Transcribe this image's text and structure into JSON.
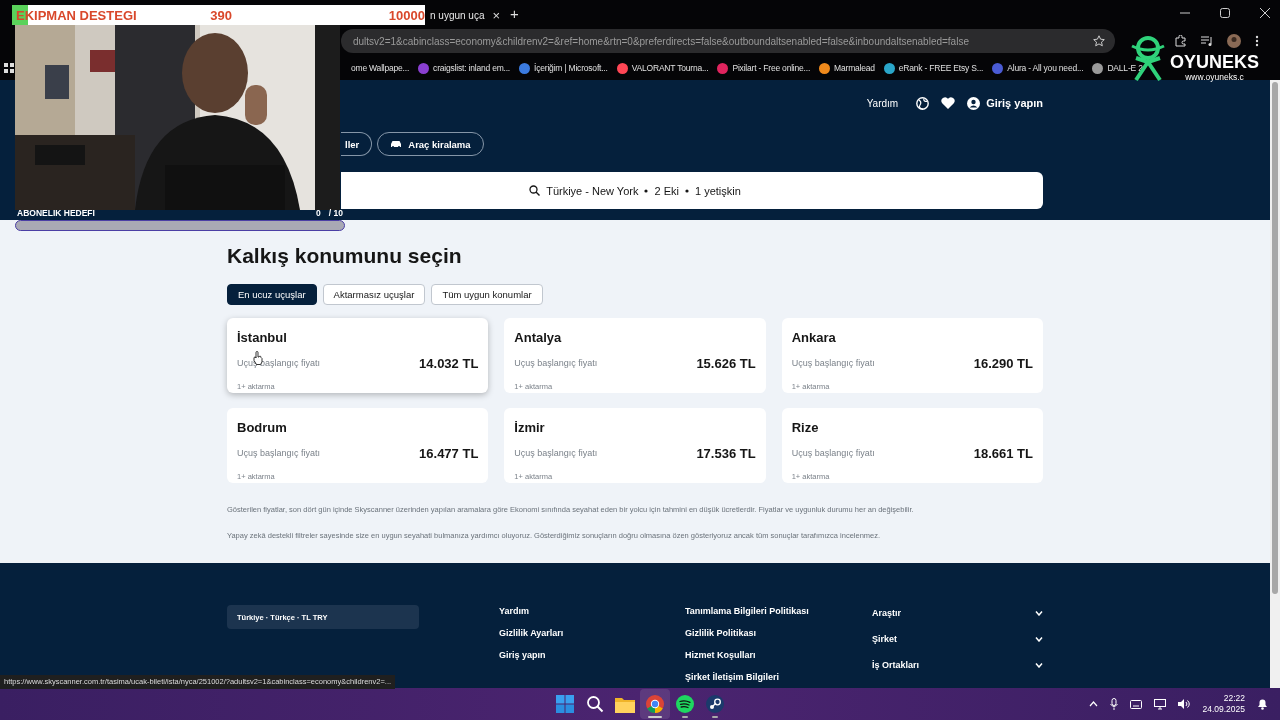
{
  "browser": {
    "tab": {
      "title": "n uygun uça",
      "close": "×"
    },
    "new_tab": "+",
    "url": "dultsv2=1&cabinclass=economy&childrenv2=&ref=home&rtn=0&preferdirects=false&outboundaltsenabled=false&inboundaltsenabled=false",
    "bookmarks": [
      {
        "label": "ome Wallpape..."
      },
      {
        "label": "craigslist: inland em...",
        "color": "#8a3fd1"
      },
      {
        "label": "İçeriğim | Microsoft...",
        "color": "#3b7be0"
      },
      {
        "label": "VALORANT Tourna...",
        "color": "#ff4655"
      },
      {
        "label": "Pixilart - Free online...",
        "color": "#e0245e"
      },
      {
        "label": "Marmalead",
        "color": "#f08a1c"
      },
      {
        "label": "eRank - FREE Etsy S...",
        "color": "#2aa6c9"
      },
      {
        "label": "Alura - All you need...",
        "color": "#4a5bd4"
      },
      {
        "label": "DALL-E 2",
        "color": "#9a9a9a"
      }
    ]
  },
  "stream_overlay": {
    "donation": {
      "label": "EKIPMAN DESTEGI",
      "current": "390",
      "goal": "10000",
      "level": 0.039
    },
    "subscription": {
      "label": "ABONELIK HEDEFI",
      "count": "0",
      "goal": "/ 10",
      "level": 0
    },
    "logo": {
      "name": "OYUNEKS",
      "url": "www.oyuneks.c"
    }
  },
  "header": {
    "help": "Yardım",
    "login": "Giriş yapın",
    "chips": [
      "ller",
      "Araç kiralama"
    ],
    "search_summary": [
      "Türkiye - New York",
      "2 Eki",
      "1 yetişkin"
    ]
  },
  "main": {
    "title": "Kalkış konumunu seçin",
    "filters": [
      {
        "label": "En ucuz uçuşlar",
        "selected": true
      },
      {
        "label": "Aktarmasız uçuşlar",
        "selected": false
      },
      {
        "label": "Tüm uygun konumlar",
        "selected": false
      }
    ],
    "cards": [
      {
        "city": "İstanbul",
        "label": "Uçuş başlangıç fiyatı",
        "price": "14.032 TL",
        "stops": "1+ aktarma",
        "hovered": true
      },
      {
        "city": "Antalya",
        "label": "Uçuş başlangıç fiyatı",
        "price": "15.626 TL",
        "stops": "1+ aktarma",
        "hovered": false
      },
      {
        "city": "Ankara",
        "label": "Uçuş başlangıç fiyatı",
        "price": "16.290 TL",
        "stops": "1+ aktarma",
        "hovered": false
      },
      {
        "city": "Bodrum",
        "label": "Uçuş başlangıç fiyatı",
        "price": "16.477 TL",
        "stops": "1+ aktarma",
        "hovered": false
      },
      {
        "city": "İzmir",
        "label": "Uçuş başlangıç fiyatı",
        "price": "17.536 TL",
        "stops": "1+ aktarma",
        "hovered": false
      },
      {
        "city": "Rize",
        "label": "Uçuş başlangıç fiyatı",
        "price": "18.661 TL",
        "stops": "1+ aktarma",
        "hovered": false
      }
    ],
    "disclaimers": [
      "Gösterilen fiyatlar, son dört gün içinde Skyscanner üzerinden yapılan aramalara göre Ekonomi sınıfında seyahat eden bir yolcu için tahmini en düşük ücretlerdir. Fiyatlar ve uygunluk durumu her an değişebilir.",
      "Yapay zekâ destekli filtreler sayesinde size en uygun seyahati bulmanıza yardımcı oluyoruz. Gösterdiğimiz sonuçların doğru olmasına özen gösteriyoruz ancak tüm sonuçlar tarafımızca incelenmez."
    ]
  },
  "footer": {
    "locale": "Türkiye · Türkçe · TL TRY",
    "links_1": [
      "Yardım",
      "Gizlilik Ayarları",
      "Giriş yapın"
    ],
    "links_2": [
      "Tanımlama Bilgileri Politikası",
      "Gizlilik Politikası",
      "Hizmet Koşulları",
      "Şirket İletişim Bilgileri"
    ],
    "sections": [
      {
        "label": "Araştır",
        "expanded": false
      },
      {
        "label": "Şirket",
        "expanded": false
      },
      {
        "label": "İş Ortakları",
        "expanded": false
      }
    ]
  },
  "status_link": "https://www.skyscanner.com.tr/tasima/ucak-bileti/ista/nyca/251002/?adultsv2=1&cabinclass=economy&childrenv2=...",
  "taskbar": {
    "apps": [
      {
        "kind": "start",
        "selected": false,
        "running": false
      },
      {
        "kind": "search",
        "selected": false,
        "running": false
      },
      {
        "kind": "folder",
        "selected": false,
        "running": false
      },
      {
        "kind": "chrome",
        "selected": true,
        "running": true
      },
      {
        "kind": "spotify",
        "selected": false,
        "running": true
      },
      {
        "kind": "steam",
        "selected": false,
        "running": true
      }
    ],
    "time": "22:22",
    "date": "24.09.2025"
  }
}
